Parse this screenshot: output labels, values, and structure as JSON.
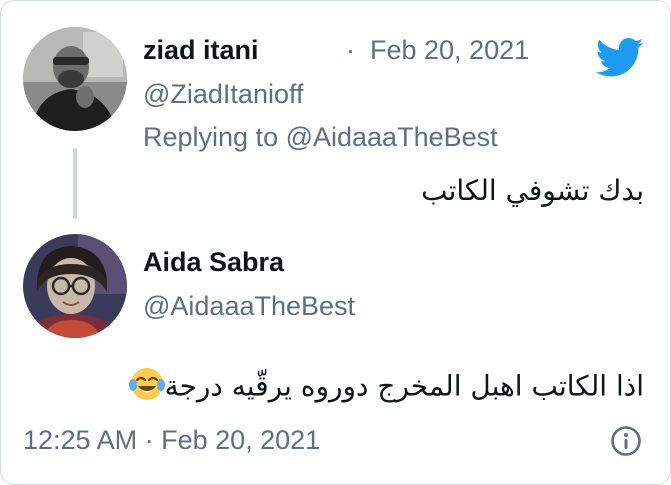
{
  "tweet": {
    "author_name": "ziad itani",
    "dot": "·",
    "date": "Feb 20, 2021",
    "handle": "@ZiadItanioff",
    "replying_to_prefix": "Replying to ",
    "replying_to_handle": "@AidaaaTheBest",
    "text": "بدك تشوفي الكاتب"
  },
  "reply": {
    "author_name": "Aida Sabra",
    "handle": "@AidaaaTheBest",
    "text": "اذا الكاتب اهبل المخرج دوروه يرقّيه درجة",
    "timestamp": "12:25 AM · Feb 20, 2021"
  },
  "icons": {
    "brand": "twitter-bird-icon",
    "info": "info-icon",
    "emoji": "face-with-tears-of-joy-emoji",
    "brand_color": "#1d9bf0"
  }
}
